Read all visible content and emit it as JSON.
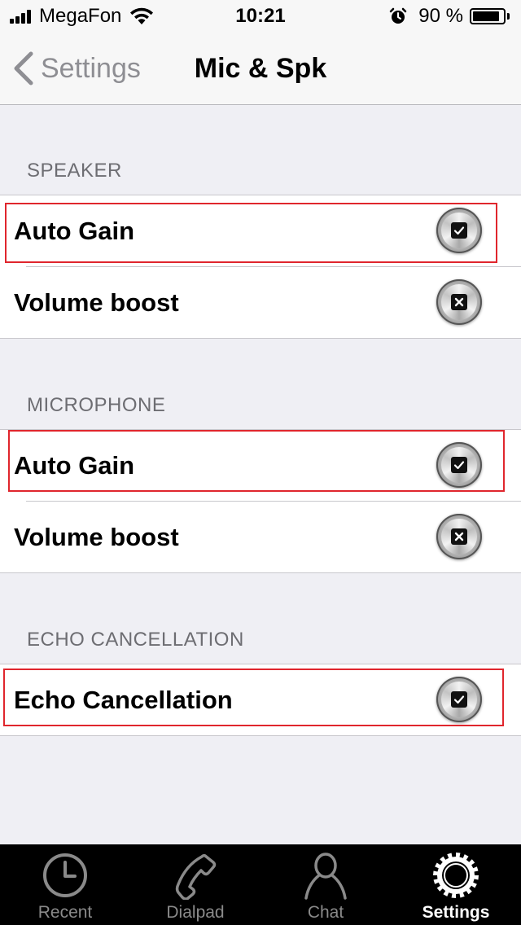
{
  "status_bar": {
    "carrier": "MegaFon",
    "time": "10:21",
    "battery_percent": "90 %",
    "battery_level": 0.9
  },
  "nav": {
    "back_label": "Settings",
    "title": "Mic & Spk"
  },
  "sections": {
    "speaker": {
      "header": "SPEAKER",
      "auto_gain": {
        "label": "Auto Gain",
        "checked": true
      },
      "volume_boost": {
        "label": "Volume boost",
        "checked": false
      }
    },
    "microphone": {
      "header": "MICROPHONE",
      "auto_gain": {
        "label": "Auto Gain",
        "checked": true
      },
      "volume_boost": {
        "label": "Volume boost",
        "checked": false
      }
    },
    "echo": {
      "header": "ECHO CANCELLATION",
      "echo_cancellation": {
        "label": "Echo Cancellation",
        "checked": true
      }
    }
  },
  "tabs": {
    "recent": {
      "label": "Recent",
      "icon": "clock-icon"
    },
    "dialpad": {
      "label": "Dialpad",
      "icon": "phone-handset-icon"
    },
    "chat": {
      "label": "Chat",
      "icon": "person-icon"
    },
    "settings": {
      "label": "Settings",
      "icon": "gear-icon",
      "active": true
    }
  },
  "colors": {
    "highlight": "#e0262d",
    "background": "#efeff4",
    "tab_bar": "#000000"
  }
}
